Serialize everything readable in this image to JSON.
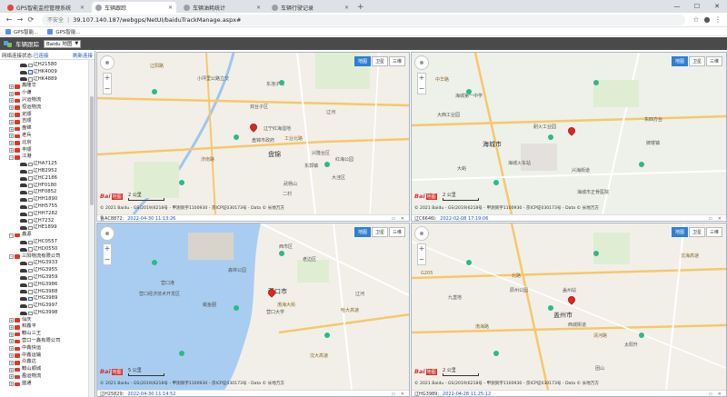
{
  "browser": {
    "tabs": [
      {
        "label": "GPS智能监控管理系统",
        "icon_color": "#e8453c"
      },
      {
        "label": "车辆跟踪",
        "icon_color": "#5f6368",
        "active": true
      },
      {
        "label": "车辆油耗统计",
        "icon_color": "#5f6368"
      },
      {
        "label": "车辆行驶记录",
        "icon_color": "#5f6368"
      }
    ],
    "new_tab": "+",
    "window_controls": {
      "minimize": "—",
      "maximize": "☐",
      "close": "✕"
    },
    "back": "←",
    "forward": "→",
    "reload": "⟳",
    "security_label": "不安全",
    "url": "39.107.140.187/webgps/NetUI/baiduTrackManage.aspx#",
    "bookmarks": [
      "GPS智能...",
      "GPS智能..."
    ]
  },
  "app": {
    "title": "车辆跟踪",
    "map_select": "Baidu 地图"
  },
  "sidebar": {
    "status_label": "网络连接状态:",
    "status_value": "已连接",
    "refresh_btn": "刷新连接",
    "tree": [
      {
        "level": 2,
        "type": "car",
        "label": "辽H21580"
      },
      {
        "level": 2,
        "type": "car",
        "checked": true,
        "label": "辽HK4009"
      },
      {
        "level": 2,
        "type": "car",
        "label": "辽HK4889"
      },
      {
        "level": 0,
        "type": "group",
        "label": "鑫隆华"
      },
      {
        "level": 0,
        "type": "group",
        "label": "小谦"
      },
      {
        "level": 0,
        "type": "group",
        "label": "兴运物流"
      },
      {
        "level": 0,
        "type": "group",
        "label": "恒运物流"
      },
      {
        "level": 0,
        "type": "group",
        "label": "定顺"
      },
      {
        "level": 0,
        "type": "group",
        "label": "吉顺"
      },
      {
        "level": 0,
        "type": "group",
        "label": "盘锦"
      },
      {
        "level": 0,
        "type": "group",
        "label": "老兵"
      },
      {
        "level": 0,
        "type": "group",
        "label": "北京"
      },
      {
        "level": 0,
        "type": "group",
        "label": "丰顺"
      },
      {
        "level": 0,
        "type": "group",
        "label": "江港",
        "expanded": true
      },
      {
        "level": 2,
        "type": "car",
        "label": "辽HA7125"
      },
      {
        "level": 2,
        "type": "car",
        "label": "辽HB2952"
      },
      {
        "level": 2,
        "type": "car",
        "label": "辽HC2186"
      },
      {
        "level": 2,
        "type": "car",
        "label": "辽HF0180"
      },
      {
        "level": 2,
        "type": "car",
        "label": "辽HF0852"
      },
      {
        "level": 2,
        "type": "car",
        "label": "辽HH1890"
      },
      {
        "level": 2,
        "type": "car",
        "label": "辽HH5755"
      },
      {
        "level": 2,
        "type": "car",
        "label": "辽HH7282"
      },
      {
        "level": 2,
        "type": "car",
        "label": "辽H7232"
      },
      {
        "level": 2,
        "type": "car",
        "label": "辽HE1899"
      },
      {
        "level": 0,
        "type": "group",
        "label": "鑫源",
        "expanded": true
      },
      {
        "level": 2,
        "type": "car",
        "label": "辽HC0557"
      },
      {
        "level": 2,
        "type": "car",
        "label": "辽HD0550"
      },
      {
        "level": 0,
        "type": "group",
        "label": "三阳物流有限公司",
        "expanded": true
      },
      {
        "level": 2,
        "type": "car",
        "label": "辽HG3933"
      },
      {
        "level": 2,
        "type": "car",
        "label": "辽HG3955"
      },
      {
        "level": 2,
        "type": "car",
        "label": "辽HG3959"
      },
      {
        "level": 2,
        "type": "car",
        "label": "辽HG3986"
      },
      {
        "level": 2,
        "type": "car",
        "label": "辽HG3988"
      },
      {
        "level": 2,
        "type": "car",
        "checked": true,
        "label": "辽HG3989"
      },
      {
        "level": 2,
        "type": "car",
        "label": "辽HG3997"
      },
      {
        "level": 2,
        "type": "car",
        "label": "辽HG3998"
      },
      {
        "level": 0,
        "type": "group",
        "label": "仙庆"
      },
      {
        "level": 0,
        "type": "group",
        "label": "和鑫平"
      },
      {
        "level": 0,
        "type": "group",
        "label": "鞍山三王"
      },
      {
        "level": 0,
        "type": "group",
        "label": "营口一鑫有限公司"
      },
      {
        "level": 0,
        "type": "group",
        "label": "中鑫快运"
      },
      {
        "level": 0,
        "type": "group",
        "label": "中鑫运输"
      },
      {
        "level": 0,
        "type": "group",
        "label": "众鑫达"
      },
      {
        "level": 0,
        "type": "group",
        "label": "鞍山顺城"
      },
      {
        "level": 0,
        "type": "group",
        "label": "盈运物流"
      },
      {
        "level": 0,
        "type": "group",
        "label": "蓝通"
      }
    ]
  },
  "map_common": {
    "type_buttons": [
      "地图",
      "卫星",
      "三维"
    ],
    "zoom_in": "+",
    "zoom_out": "−",
    "brand_text": "Bai",
    "brand_tag": "地图",
    "footer_controls": "▭ ✕",
    "copyright": "© 2021 Baidu - GS(2019)6218号 - 甲测资字1100930 - 京ICP证030173号 - Data © 长地万方"
  },
  "panels": [
    {
      "plate": "鲁AC8872:",
      "time": "2022-04-30 11:13:26",
      "scale": "2 公里",
      "labels": [
        {
          "text": "辽阳路",
          "cls": "road"
        },
        {
          "text": "小坪里公路立交",
          "cls": ""
        },
        {
          "text": "东泡子村",
          "cls": ""
        },
        {
          "text": "双台子区",
          "cls": ""
        },
        {
          "text": "辽宁红海湿地",
          "cls": ""
        },
        {
          "text": "盘锦市政府",
          "cls": ""
        },
        {
          "text": "工业北路",
          "cls": "road"
        },
        {
          "text": "盘锦",
          "cls": "city"
        },
        {
          "text": "兴隆台区",
          "cls": ""
        },
        {
          "text": "红海公园",
          "cls": ""
        },
        {
          "text": "东郭镇",
          "cls": ""
        },
        {
          "text": "大洼区",
          "cls": ""
        },
        {
          "text": "武杨山",
          "cls": ""
        },
        {
          "text": "二村",
          "cls": ""
        },
        {
          "text": "济南路",
          "cls": "road"
        },
        {
          "text": "辽河",
          "cls": ""
        }
      ]
    },
    {
      "plate": "辽C6646l:",
      "time": "2022-02-08 17:19:06",
      "scale": "2 公里",
      "labels": [
        {
          "text": "中华路",
          "cls": "road"
        },
        {
          "text": "大西工业园",
          "cls": ""
        },
        {
          "text": "海城市",
          "cls": "city"
        },
        {
          "text": "海城第一中学",
          "cls": ""
        },
        {
          "text": "耐火工业园",
          "cls": ""
        },
        {
          "text": "海城火车站",
          "cls": ""
        },
        {
          "text": "海城市正骨医院",
          "cls": ""
        },
        {
          "text": "大峪",
          "cls": ""
        },
        {
          "text": "牌楼镇",
          "cls": ""
        },
        {
          "text": "兴海街道",
          "cls": ""
        },
        {
          "text": "东四方台",
          "cls": ""
        },
        {
          "text": "腾鳌镇",
          "cls": ""
        }
      ]
    },
    {
      "plate": "辽H25829:",
      "time": "2022-04-30 11:14:52",
      "scale": "5 公里",
      "labels": [
        {
          "text": "西市区",
          "cls": ""
        },
        {
          "text": "营口市",
          "cls": "city"
        },
        {
          "text": "鲅鱼圈",
          "cls": ""
        },
        {
          "text": "老边区",
          "cls": ""
        },
        {
          "text": "营口港",
          "cls": ""
        },
        {
          "text": "渤海大街",
          "cls": "road"
        },
        {
          "text": "森林公园",
          "cls": ""
        },
        {
          "text": "营口大学",
          "cls": ""
        },
        {
          "text": "辽河",
          "cls": ""
        },
        {
          "text": "沈大高速",
          "cls": "road"
        },
        {
          "text": "营口经济技术开发区",
          "cls": ""
        },
        {
          "text": "哈大高速",
          "cls": "road"
        }
      ]
    },
    {
      "plate": "辽HG3989:",
      "time": "2022-04-28 11:25:12",
      "scale": "2 公里",
      "labels": [
        {
          "text": "G205",
          "cls": "road"
        },
        {
          "text": "北路",
          "cls": "road"
        },
        {
          "text": "渤海路",
          "cls": "road"
        },
        {
          "text": "盖州市",
          "cls": "city"
        },
        {
          "text": "西城街道",
          "cls": ""
        },
        {
          "text": "辰州公园",
          "cls": ""
        },
        {
          "text": "盖州站",
          "cls": ""
        },
        {
          "text": "清河路",
          "cls": "road"
        },
        {
          "text": "太阳升",
          "cls": ""
        },
        {
          "text": "沈海高速",
          "cls": "road"
        },
        {
          "text": "九垄地",
          "cls": ""
        },
        {
          "text": "团山",
          "cls": ""
        }
      ]
    }
  ]
}
